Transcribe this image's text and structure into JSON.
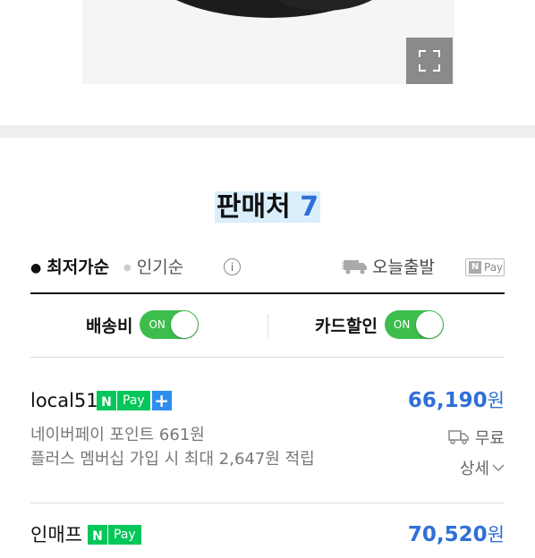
{
  "product_image": {
    "expand_icon": "expand-icon"
  },
  "sellers_header": {
    "title": "판매처",
    "count": "7"
  },
  "sort": {
    "active": "최저가순",
    "inactive": "인기순",
    "info_icon": "i",
    "today_delivery": "오늘출발",
    "npay_filter": "Pay"
  },
  "toggles": {
    "shipping": {
      "label": "배송비",
      "state": "ON"
    },
    "card_discount": {
      "label": "카드할인",
      "state": "ON"
    }
  },
  "sellers": [
    {
      "name": "local51",
      "npay": "Pay",
      "price": "66,190",
      "currency": "원",
      "point": "네이버페이 포인트 661원",
      "plus_info": "플러스 멤버십 가입 시 최대 2,647원 적립",
      "shipping": "무료",
      "detail": "상세"
    },
    {
      "name": "인매프",
      "npay": "Pay",
      "price": "70,520",
      "currency": "원"
    }
  ],
  "colors": {
    "accent": "#2f6fd8",
    "npay_green": "#03c75a",
    "toggle_on": "#3dbd4c"
  }
}
